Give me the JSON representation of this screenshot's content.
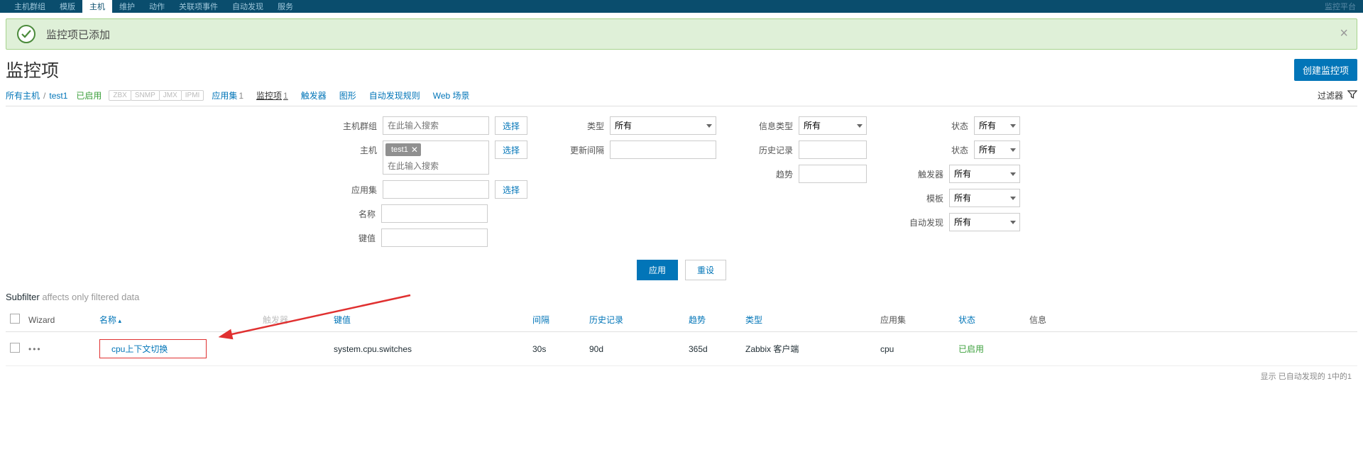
{
  "topnav": {
    "items": [
      "主机群组",
      "模版",
      "主机",
      "维护",
      "动作",
      "关联项事件",
      "自动发现",
      "服务"
    ],
    "active_index": 2,
    "right_label": "监控平台"
  },
  "alert": {
    "text": "监控项已添加"
  },
  "page": {
    "title": "监控项",
    "create_btn": "创建监控项"
  },
  "breadcrumb": {
    "all_hosts": "所有主机",
    "host": "test1",
    "enabled": "已启用"
  },
  "proto_tags": [
    "ZBX",
    "SNMP",
    "JMX",
    "IPMI"
  ],
  "conf_tabs": [
    {
      "label": "应用集",
      "count": "1"
    },
    {
      "label": "监控项",
      "count": "1",
      "active": true
    },
    {
      "label": "触发器"
    },
    {
      "label": "图形"
    },
    {
      "label": "自动发现规则"
    },
    {
      "label": "Web 场景"
    }
  ],
  "filter_toggle": "过滤器",
  "filter": {
    "col1": {
      "hostgroup_label": "主机群组",
      "hostgroup_placeholder": "在此输入搜索",
      "hostgroup_select": "选择",
      "host_label": "主机",
      "host_chip": "test1",
      "host_placeholder": "在此输入搜索",
      "host_select": "选择",
      "appset_label": "应用集",
      "appset_select": "选择",
      "name_label": "名称",
      "key_label": "键值"
    },
    "col2": {
      "type_label": "类型",
      "type_value": "所有",
      "interval_label": "更新间隔"
    },
    "col3": {
      "infotype_label": "信息类型",
      "infotype_value": "所有",
      "history_label": "历史记录",
      "trend_label": "趋势"
    },
    "col4": {
      "state1_label": "状态",
      "state1_value": "所有",
      "state2_label": "状态",
      "state2_value": "所有",
      "trigger_label": "触发器",
      "trigger_value": "所有",
      "template_label": "模板",
      "template_value": "所有",
      "autodisc_label": "自动发现",
      "autodisc_value": "所有"
    },
    "apply": "应用",
    "reset": "重设"
  },
  "subfilter": {
    "label": "Subfilter",
    "hint": "affects only filtered data"
  },
  "table": {
    "headers": {
      "wizard": "Wizard",
      "name": "名称",
      "trigger": "触发器",
      "key": "键值",
      "interval": "间隔",
      "history": "历史记录",
      "trend": "趋势",
      "type": "类型",
      "appset": "应用集",
      "status": "状态",
      "info": "信息"
    },
    "row": {
      "dots": "•••",
      "name": "cpu上下文切换",
      "key": "system.cpu.switches",
      "interval": "30s",
      "history": "90d",
      "trend": "365d",
      "type": "Zabbix 客户端",
      "appset": "cpu",
      "status": "已启用"
    }
  },
  "footer": "显示 已自动发现的 1中的1"
}
